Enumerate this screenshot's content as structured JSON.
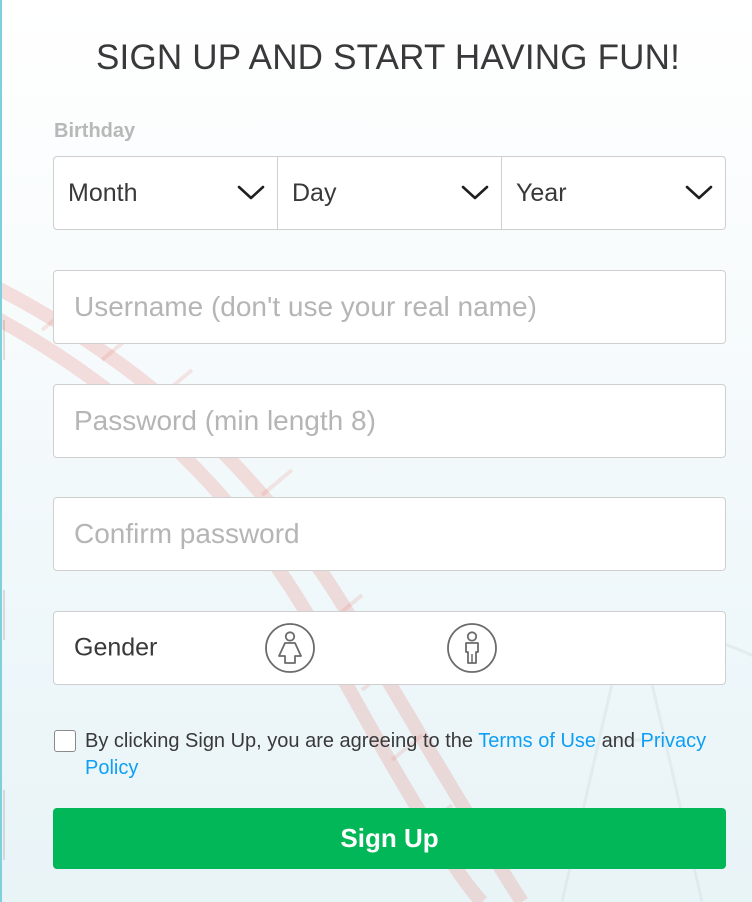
{
  "form": {
    "title": "SIGN UP AND START HAVING FUN!",
    "birthday": {
      "label": "Birthday",
      "month": "Month",
      "day": "Day",
      "year": "Year"
    },
    "username": {
      "placeholder": "Username (don't use your real name)",
      "value": ""
    },
    "password": {
      "placeholder": "Password (min length 8)",
      "value": ""
    },
    "confirm_password": {
      "placeholder": "Confirm password",
      "value": ""
    },
    "gender": {
      "label": "Gender",
      "options": [
        "female-icon",
        "male-icon"
      ]
    },
    "terms": {
      "prefix": "By clicking Sign Up, you are agreeing to the ",
      "terms_link": "Terms of Use",
      "conjunction": " and ",
      "privacy_link": "Privacy Policy",
      "checked": false
    },
    "submit_label": "Sign Up"
  },
  "colors": {
    "accent_green": "#02b757",
    "link_blue": "#0e9ff5",
    "text": "#39393b",
    "placeholder": "#b5b5b5",
    "border": "#cfcfcf"
  }
}
